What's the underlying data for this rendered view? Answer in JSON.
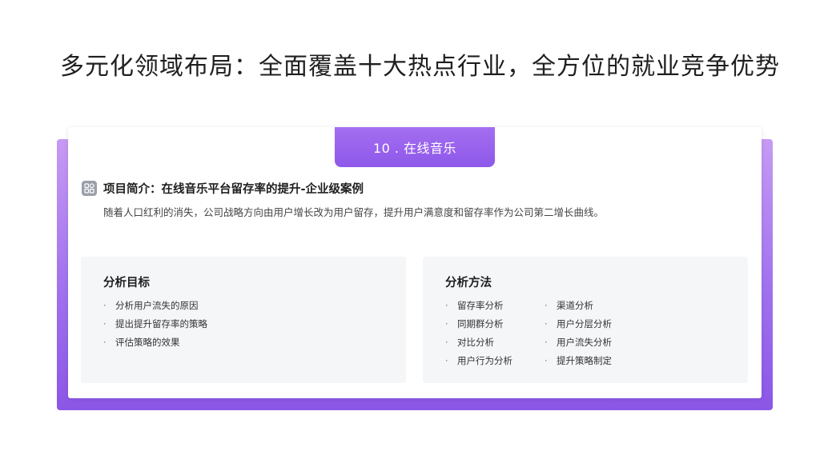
{
  "main_title": "多元化领域布局：全面覆盖十大热点行业，全方位的就业竞争优势",
  "tab_label": "10 . 在线音乐",
  "intro": {
    "title": "项目简介：在线音乐平台留存率的提升-企业级案例",
    "description": "随着人口红利的消失，公司战略方向由用户增长改为用户留存，提升用户满意度和留存率作为公司第二增长曲线。",
    "icon": "grid-icon"
  },
  "goals": {
    "title": "分析目标",
    "items": [
      "分析用户流失的原因",
      "提出提升留存率的策略",
      "评估策略的效果"
    ]
  },
  "methods": {
    "title": "分析方法",
    "col1": [
      "留存率分析",
      "同期群分析",
      "对比分析",
      "用户行为分析"
    ],
    "col2": [
      "渠道分析",
      "用户分层分析",
      "用户流失分析",
      "提升策略制定"
    ]
  },
  "colors": {
    "accent": "#9460ec",
    "frame_top": "#c69af3",
    "frame_bottom": "#8b56e6",
    "panel_bg": "#f5f6f8"
  }
}
